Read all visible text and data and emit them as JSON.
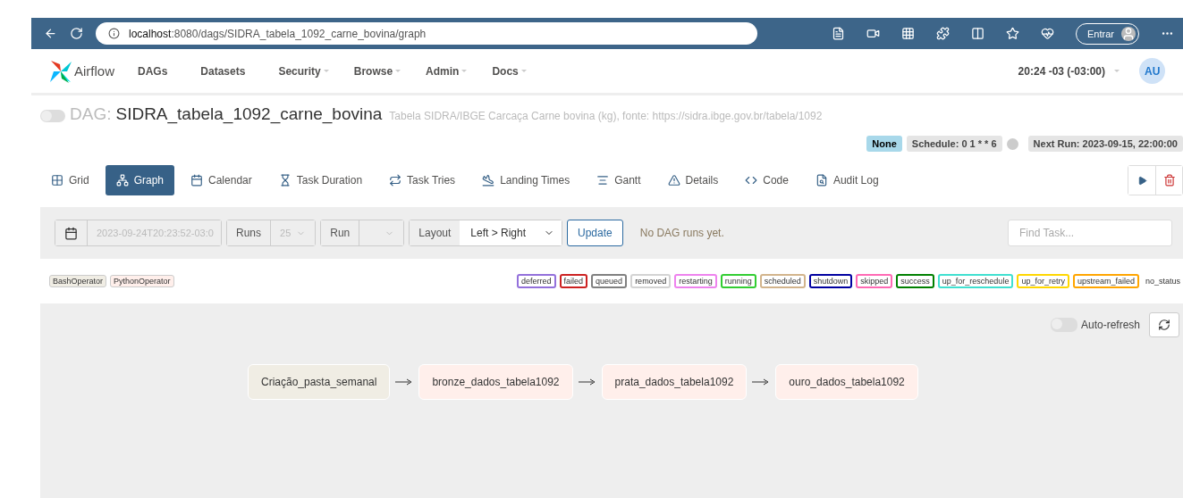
{
  "browser": {
    "url_host": "localhost",
    "url_path": ":8080/dags/SIDRA_tabela_1092_carne_bovina/graph",
    "profile_button": "Entrar"
  },
  "navbar": {
    "brand": "Airflow",
    "items": [
      {
        "label": "DAGs",
        "dropdown": false
      },
      {
        "label": "Datasets",
        "dropdown": false
      },
      {
        "label": "Security",
        "dropdown": true
      },
      {
        "label": "Browse",
        "dropdown": true
      },
      {
        "label": "Admin",
        "dropdown": true
      },
      {
        "label": "Docs",
        "dropdown": true
      }
    ],
    "clock": "20:24 -03 (-03:00)",
    "user_initials": "AU"
  },
  "dag": {
    "paused_toggle_on": false,
    "prefix": "DAG:",
    "name": "SIDRA_tabela_1092_carne_bovina",
    "description": "Tabela SIDRA/IBGE Carcaça Carne bovina (kg), fonte: https://sidra.ibge.gov.br/tabela/1092",
    "badges": [
      {
        "kind": "dataset",
        "label": "None"
      },
      {
        "kind": "schedule",
        "label": "Schedule: 0 1 * * 6"
      },
      {
        "kind": "info"
      },
      {
        "kind": "next",
        "label": "Next Run: 2023-09-15, 22:00:00"
      }
    ]
  },
  "tabs": [
    {
      "label": "Grid",
      "selected": false
    },
    {
      "label": "Graph",
      "selected": true
    },
    {
      "label": "Calendar",
      "selected": false
    },
    {
      "label": "Task Duration",
      "selected": false
    },
    {
      "label": "Task Tries",
      "selected": false
    },
    {
      "label": "Landing Times",
      "selected": false
    },
    {
      "label": "Gantt",
      "selected": false
    },
    {
      "label": "Details",
      "selected": false
    },
    {
      "label": "Code",
      "selected": false
    },
    {
      "label": "Audit Log",
      "selected": false
    }
  ],
  "toolbar": {
    "date_value": "2023-09-24T20:23:52-03:0",
    "runs_label": "Runs",
    "runs_value": "25",
    "run_label": "Run",
    "layout_label": "Layout",
    "layout_value": "Left > Right",
    "update_button": "Update",
    "message": "No DAG runs yet.",
    "find_placeholder": "Find Task..."
  },
  "operators": [
    {
      "label": "BashOperator",
      "color": "#f0ede4"
    },
    {
      "label": "PythonOperator",
      "color": "#ffefeb"
    }
  ],
  "states": [
    {
      "label": "deferred",
      "color": "#9370db"
    },
    {
      "label": "failed",
      "color": "#cc2222"
    },
    {
      "label": "queued",
      "color": "#808080"
    },
    {
      "label": "removed",
      "color": "#d3d3d3"
    },
    {
      "label": "restarting",
      "color": "#ee82ee"
    },
    {
      "label": "running",
      "color": "#32cd32"
    },
    {
      "label": "scheduled",
      "color": "#d2b48c"
    },
    {
      "label": "shutdown",
      "color": "#0000a0"
    },
    {
      "label": "skipped",
      "color": "#ff69b4"
    },
    {
      "label": "success",
      "color": "#008000"
    },
    {
      "label": "up_for_reschedule",
      "color": "#40e0d0"
    },
    {
      "label": "up_for_retry",
      "color": "#ffd700"
    },
    {
      "label": "upstream_failed",
      "color": "#ffa500"
    },
    {
      "label": "no_status"
    }
  ],
  "graph": {
    "auto_refresh_on": false,
    "auto_refresh_label": "Auto-refresh",
    "nodes": [
      {
        "label": "Criação_pasta_semanal",
        "color": "#f0ede4"
      },
      {
        "label": "bronze_dados_tabela1092",
        "color": "#ffefeb"
      },
      {
        "label": "prata_dados_tabela1092",
        "color": "#ffefeb"
      },
      {
        "label": "ouro_dados_tabela1092",
        "color": "#ffefeb"
      }
    ]
  }
}
